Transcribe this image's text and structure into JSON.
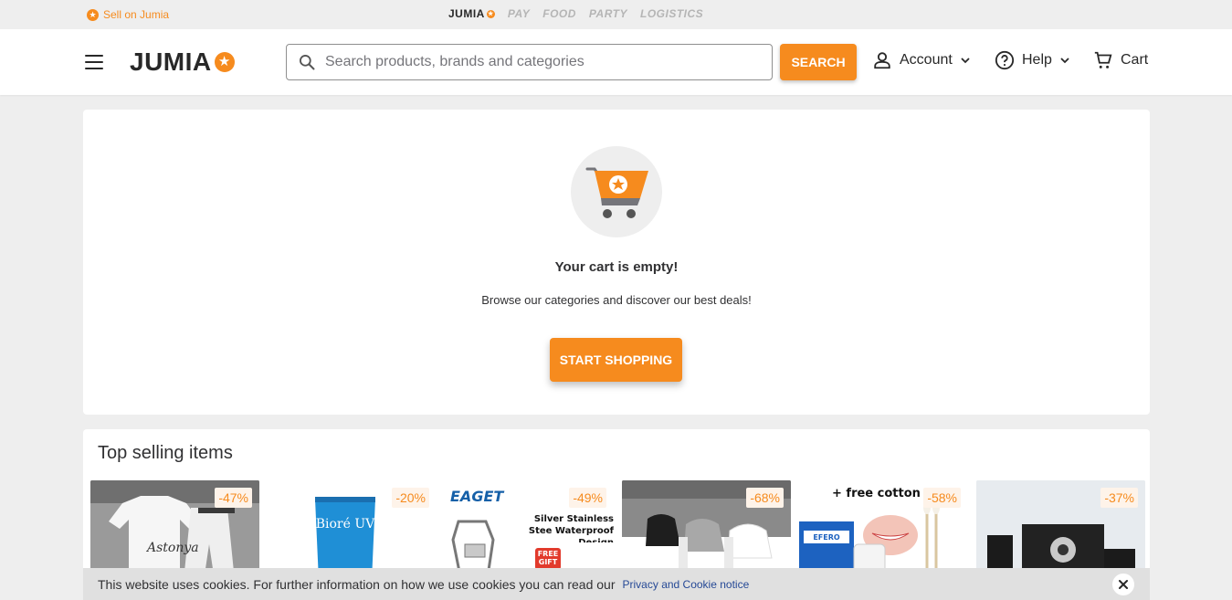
{
  "topbar": {
    "sell_label": "Sell on Jumia",
    "brands": {
      "main": "JUMIA",
      "pay": "PAY",
      "food": "FOOD",
      "party": "PARTY",
      "logistics": "LOGISTICS"
    }
  },
  "header": {
    "logo": "JUMIA",
    "search": {
      "placeholder": "Search products, brands and categories",
      "value": "",
      "button": "SEARCH"
    },
    "account_label": "Account",
    "help_label": "Help",
    "cart_label": "Cart"
  },
  "empty_cart": {
    "title": "Your cart is empty!",
    "subtitle": "Browse our categories and discover our best deals!",
    "button": "START SHOPPING"
  },
  "top_selling": {
    "title": "Top selling items",
    "products": [
      {
        "discount": "-47%",
        "image_text": "Astonya"
      },
      {
        "discount": "-20%",
        "image_text": "Bioré UV"
      },
      {
        "discount": "-49%",
        "brand": "EAGET",
        "caption": "Silver Stainless Stee Waterproof Design",
        "badge": "FREE GIFT"
      },
      {
        "discount": "-68%"
      },
      {
        "discount": "-58%",
        "caption": "+ free cotton bu",
        "brand": "EFERO"
      },
      {
        "discount": "-37%"
      }
    ]
  },
  "cookie": {
    "text": "This website uses cookies. For further information on how we use cookies you can read our",
    "link": "Privacy and Cookie notice"
  },
  "colors": {
    "accent": "#f68b1e",
    "background": "#eeeeee",
    "link": "#264996"
  }
}
